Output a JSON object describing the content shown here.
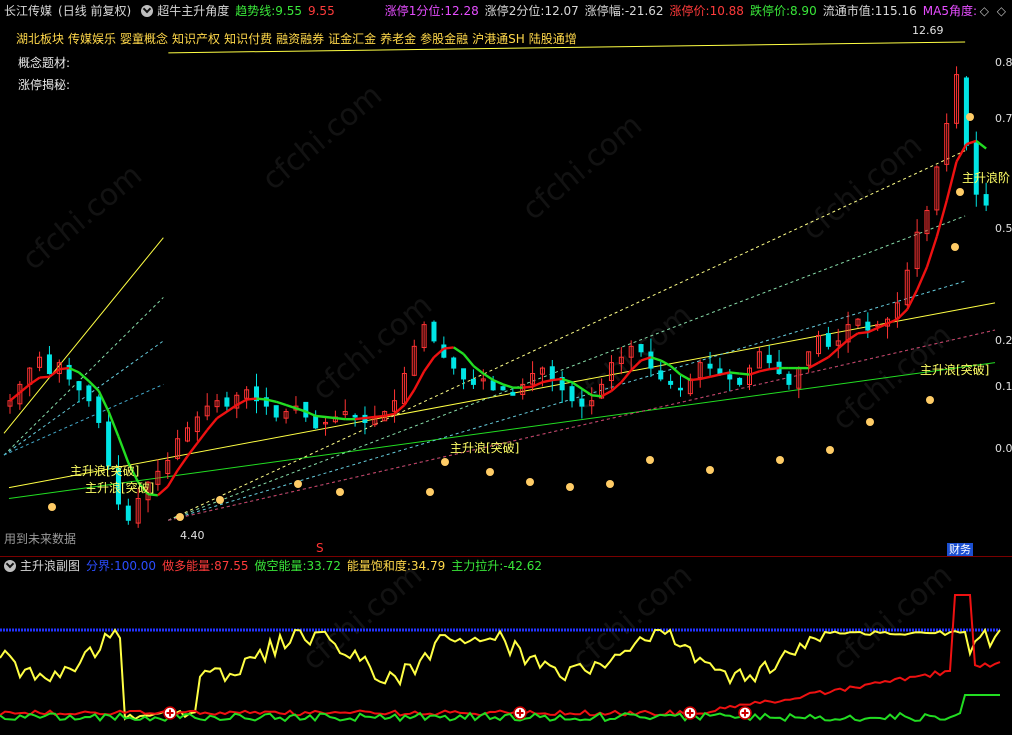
{
  "header": {
    "stock_name": "长江传媒",
    "period": "(日线 前复权)",
    "indicator": "超牛主升角度",
    "trend_label": "趋势线:",
    "trend_val1": "9.55",
    "trend_val2": "9.55",
    "lu1_label": "涨停1分位:",
    "lu1_val": "12.28",
    "lu2_label": "涨停2分位:",
    "lu2_val": "12.07",
    "lu_range_label": "涨停幅:",
    "lu_range_val": "-21.62",
    "lu_price_label": "涨停价:",
    "lu_price_val": "10.88",
    "ld_price_label": "跌停价:",
    "ld_price_val": "8.90",
    "mcap_label": "流通市值:",
    "mcap_val": "115.16",
    "ma5_label": "MA5角度:",
    "corner_icons": "◇ ◇"
  },
  "concept_blocks": [
    "湖北板块",
    "传媒娱乐",
    "婴童概念",
    "知识产权",
    "知识付费",
    "融资融券",
    "证金汇金",
    "养老金",
    "参股金融",
    "沪港通SH",
    "陆股通增"
  ],
  "concept_label": "概念题材:",
  "limitup_label": "涨停揭秘:",
  "future_note": "用到未来数据",
  "finance_tag": "财务",
  "sub": {
    "title": "主升浪副图",
    "boundary_label": "分界:",
    "boundary_val": "100.00",
    "bull_label": "做多能量:",
    "bull_val": "87.55",
    "bear_label": "做空能量:",
    "bear_val": "33.72",
    "sat_label": "能量饱和度:",
    "sat_val": "34.79",
    "main_label": "主力拉升:",
    "main_val": "-42.62"
  },
  "colors": {
    "up": "#ff3333",
    "down": "#00e5e5",
    "ma_green": "#22dd22",
    "ma_red": "#ee1111",
    "yellow": "#ffff44",
    "blue": "#2233ff"
  },
  "chart_data": [
    {
      "type": "candlestick",
      "title": "超牛主升角度",
      "price_labels": [
        "12.69",
        "4.40"
      ],
      "axis_labels": [
        "0.8",
        "0.7",
        "0.5",
        "0.2",
        "0.1",
        "0.0"
      ],
      "annotations": [
        "主升浪[突破]",
        "主升浪[突破]",
        "主升浪[突破]",
        "主升浪[突破]",
        "主升浪阶"
      ],
      "signal_marks": [
        "S"
      ],
      "x_range": [
        0,
        1000
      ],
      "y_range": [
        4.0,
        13.2
      ],
      "closes": [
        6.6,
        6.9,
        7.2,
        7.4,
        7.1,
        7.3,
        7.0,
        6.8,
        6.6,
        6.2,
        5.4,
        4.7,
        4.4,
        4.8,
        5.1,
        5.3,
        5.5,
        5.9,
        6.1,
        6.3,
        6.5,
        6.6,
        6.5,
        6.7,
        6.8,
        6.6,
        6.5,
        6.3,
        6.4,
        6.5,
        6.3,
        6.1,
        6.2,
        6.3,
        6.4,
        6.3,
        6.2,
        6.3,
        6.4,
        6.6,
        7.1,
        7.6,
        8.0,
        7.7,
        7.4,
        7.2,
        7.0,
        6.9,
        7.0,
        6.8,
        6.8,
        6.7,
        6.9,
        7.1,
        7.2,
        7.0,
        6.8,
        6.6,
        6.5,
        6.6,
        6.9,
        7.3,
        7.4,
        7.6,
        7.5,
        7.2,
        7.0,
        6.9,
        6.8,
        7.0,
        7.3,
        7.2,
        7.1,
        7.0,
        6.9,
        7.2,
        7.5,
        7.3,
        7.1,
        6.9,
        7.2,
        7.5,
        7.8,
        7.6,
        7.7,
        8.0,
        8.1,
        7.9,
        8.0,
        8.1,
        8.4,
        9.0,
        9.7,
        10.1,
        10.9,
        11.7,
        12.6,
        11.3,
        10.4,
        10.2
      ],
      "lines": [
        {
          "name": "",
          "color": "#ffff44",
          "points": [
            [
              165,
              13.0
            ],
            [
              965,
              13.2
            ]
          ]
        },
        {
          "name": "",
          "color": "#ffff44",
          "points": [
            [
              0,
              6.0
            ],
            [
              160,
              9.6
            ]
          ]
        },
        {
          "name": "",
          "color": "#22dd22",
          "points": [
            [
              5,
              4.8
            ],
            [
              995,
              7.3
            ]
          ]
        },
        {
          "name": "",
          "color": "#ffff44",
          "points": [
            [
              5,
              5.0
            ],
            [
              995,
              8.4
            ]
          ]
        }
      ],
      "sub_series": [
        {
          "name": "分界",
          "color": "#2233ff",
          "values": [
            100
          ]
        },
        {
          "name": "做多能量",
          "color": "#ee1111"
        },
        {
          "name": "做空能量",
          "color": "#22dd22"
        },
        {
          "name": "能量饱和度",
          "color": "#ffff44"
        }
      ]
    }
  ]
}
